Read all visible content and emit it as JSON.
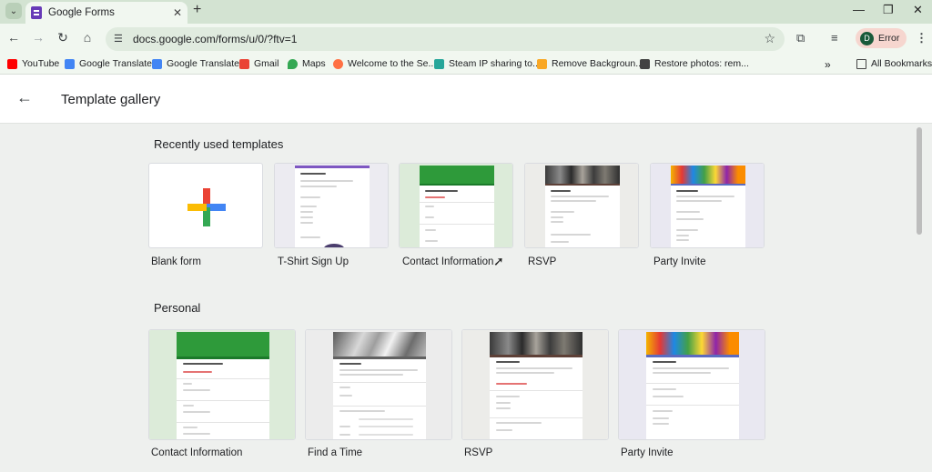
{
  "browser": {
    "tab": {
      "title": "Google Forms"
    },
    "omnibox": {
      "url": "docs.google.com/forms/u/0/?ftv=1"
    },
    "profile": {
      "initial": "D",
      "label": "Error"
    },
    "bookmarks": [
      {
        "label": "YouTube",
        "icon": "youtube-icon",
        "color": "#ff0000"
      },
      {
        "label": "Google Translate",
        "icon": "translate-icon",
        "color": "#4285f4"
      },
      {
        "label": "Google Translate",
        "icon": "translate-icon",
        "color": "#4285f4"
      },
      {
        "label": "Gmail",
        "icon": "gmail-icon",
        "color": "#ea4335"
      },
      {
        "label": "Maps",
        "icon": "maps-icon",
        "color": "#34a853"
      },
      {
        "label": "Welcome to the Se...",
        "icon": "site-icon",
        "color": "#ff7043"
      },
      {
        "label": "Steam IP sharing to...",
        "icon": "site-icon",
        "color": "#26a69a"
      },
      {
        "label": "Remove Backgroun...",
        "icon": "site-icon",
        "color": "#f9a825"
      },
      {
        "label": "Restore photos: rem...",
        "icon": "site-icon",
        "color": "#424242"
      }
    ],
    "all_bookmarks": "All Bookmarks"
  },
  "app": {
    "title": "Template gallery"
  },
  "sections": {
    "recent": {
      "title": "Recently used templates",
      "items": [
        "Blank form",
        "T-Shirt Sign Up",
        "Contact Information",
        "RSVP",
        "Party Invite"
      ]
    },
    "personal": {
      "title": "Personal",
      "items": [
        "Contact Information",
        "Find a Time",
        "RSVP",
        "Party Invite"
      ]
    }
  },
  "previews": {
    "tshirt_title": "T-Shirt Sign Up",
    "contact_title": "Contact information",
    "rsvp_title": "Event RSVP",
    "party_title": "Party Invite",
    "find_title": "Find a Time"
  },
  "colors": {
    "google_blue": "#4285f4",
    "google_red": "#ea4335",
    "google_yellow": "#fbbc04",
    "google_green": "#34a853",
    "forms_purple": "#673ab7",
    "contact_green": "#2e9a3a"
  }
}
